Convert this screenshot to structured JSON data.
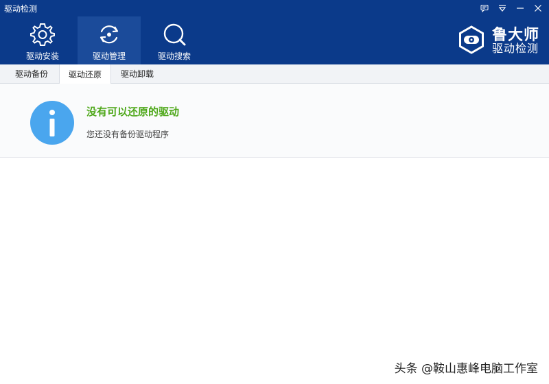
{
  "window": {
    "title": "驱动检测",
    "controls": [
      "feedback-icon",
      "menu-icon",
      "minimize-icon",
      "close-icon"
    ]
  },
  "toolbar": {
    "items": [
      {
        "label": "驱动安装",
        "icon": "gear-icon"
      },
      {
        "label": "驱动管理",
        "icon": "refresh-icon",
        "active": true
      },
      {
        "label": "驱动搜索",
        "icon": "search-icon"
      }
    ]
  },
  "brand": {
    "line1": "鲁大师",
    "line2": "驱动检测"
  },
  "tabs": [
    {
      "label": "驱动备份"
    },
    {
      "label": "驱动还原",
      "active": true
    },
    {
      "label": "驱动卸载"
    }
  ],
  "info": {
    "icon": "info-icon",
    "heading": "没有可以还原的驱动",
    "subtext": "您还没有备份驱动程序"
  },
  "watermark": "头条 @鞍山惠峰电脑工作室",
  "colors": {
    "header_blue": "#0b3a8a",
    "active_tool": "#1b4b9a",
    "heading_green": "#4fa81b",
    "info_blue": "#4aa6ee"
  }
}
